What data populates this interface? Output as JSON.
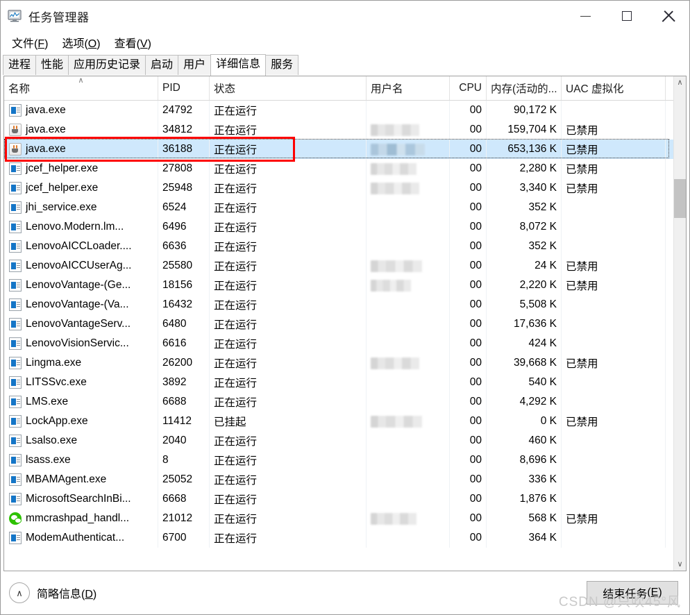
{
  "window": {
    "title": "任务管理器",
    "icon": "task-manager-icon",
    "controls": {
      "minimize": "—",
      "maximize": "□",
      "close": "✕"
    }
  },
  "menu": [
    {
      "label": "文件(F)",
      "text": "文件",
      "mnemonic": "F"
    },
    {
      "label": "选项(O)",
      "text": "选项",
      "mnemonic": "O"
    },
    {
      "label": "查看(V)",
      "text": "查看",
      "mnemonic": "V"
    }
  ],
  "tabs": [
    {
      "label": "进程",
      "active": false
    },
    {
      "label": "性能",
      "active": false
    },
    {
      "label": "应用历史记录",
      "active": false
    },
    {
      "label": "启动",
      "active": false
    },
    {
      "label": "用户",
      "active": false
    },
    {
      "label": "详细信息",
      "active": true
    },
    {
      "label": "服务",
      "active": false
    }
  ],
  "table": {
    "columns": [
      {
        "key": "name",
        "label": "名称",
        "align": "left",
        "sorted": true,
        "sort_dir": "asc"
      },
      {
        "key": "pid",
        "label": "PID",
        "align": "left"
      },
      {
        "key": "state",
        "label": "状态",
        "align": "left"
      },
      {
        "key": "user",
        "label": "用户名",
        "align": "left"
      },
      {
        "key": "cpu",
        "label": "CPU",
        "align": "right"
      },
      {
        "key": "mem",
        "label": "内存(活动的...",
        "align": "right"
      },
      {
        "key": "uac",
        "label": "UAC 虚拟化",
        "align": "left"
      }
    ],
    "sort_indicator": "∧",
    "rows": [
      {
        "icon": "generic-app-icon",
        "name": "java.exe",
        "pid": "24792",
        "state": "正在运行",
        "user_blurred": false,
        "user_width": "",
        "cpu": "00",
        "mem": "90,172 K",
        "uac": "",
        "selected": false
      },
      {
        "icon": "java-icon",
        "name": "java.exe",
        "pid": "34812",
        "state": "正在运行",
        "user_blurred": true,
        "user_width": "b1",
        "cpu": "00",
        "mem": "159,704 K",
        "uac": "已禁用",
        "selected": false
      },
      {
        "icon": "java-icon",
        "name": "java.exe",
        "pid": "36188",
        "state": "正在运行",
        "user_blurred": true,
        "user_width": "b2",
        "cpu": "00",
        "mem": "653,136 K",
        "uac": "已禁用",
        "selected": true
      },
      {
        "icon": "generic-app-icon",
        "name": "jcef_helper.exe",
        "pid": "27808",
        "state": "正在运行",
        "user_blurred": true,
        "user_width": "b3",
        "cpu": "00",
        "mem": "2,280 K",
        "uac": "已禁用",
        "selected": false
      },
      {
        "icon": "generic-app-icon",
        "name": "jcef_helper.exe",
        "pid": "25948",
        "state": "正在运行",
        "user_blurred": true,
        "user_width": "b1",
        "cpu": "00",
        "mem": "3,340 K",
        "uac": "已禁用",
        "selected": false
      },
      {
        "icon": "generic-app-icon",
        "name": "jhi_service.exe",
        "pid": "6524",
        "state": "正在运行",
        "user_blurred": false,
        "user_width": "",
        "cpu": "00",
        "mem": "352 K",
        "uac": "",
        "selected": false
      },
      {
        "icon": "generic-app-icon",
        "name": "Lenovo.Modern.lm...",
        "pid": "6496",
        "state": "正在运行",
        "user_blurred": false,
        "user_width": "",
        "cpu": "00",
        "mem": "8,072 K",
        "uac": "",
        "selected": false
      },
      {
        "icon": "generic-app-icon",
        "name": "LenovoAICCLoader....",
        "pid": "6636",
        "state": "正在运行",
        "user_blurred": false,
        "user_width": "",
        "cpu": "00",
        "mem": "352 K",
        "uac": "",
        "selected": false
      },
      {
        "icon": "generic-app-icon",
        "name": "LenovoAICCUserAg...",
        "pid": "25580",
        "state": "正在运行",
        "user_blurred": true,
        "user_width": "b5",
        "cpu": "00",
        "mem": "24 K",
        "uac": "已禁用",
        "selected": false
      },
      {
        "icon": "generic-app-icon",
        "name": "LenovoVantage-(Ge...",
        "pid": "18156",
        "state": "正在运行",
        "user_blurred": true,
        "user_width": "b4",
        "cpu": "00",
        "mem": "2,220 K",
        "uac": "已禁用",
        "selected": false
      },
      {
        "icon": "generic-app-icon",
        "name": "LenovoVantage-(Va...",
        "pid": "16432",
        "state": "正在运行",
        "user_blurred": false,
        "user_width": "",
        "cpu": "00",
        "mem": "5,508 K",
        "uac": "",
        "selected": false
      },
      {
        "icon": "generic-app-icon",
        "name": "LenovoVantageServ...",
        "pid": "6480",
        "state": "正在运行",
        "user_blurred": false,
        "user_width": "",
        "cpu": "00",
        "mem": "17,636 K",
        "uac": "",
        "selected": false
      },
      {
        "icon": "generic-app-icon",
        "name": "LenovoVisionServic...",
        "pid": "6616",
        "state": "正在运行",
        "user_blurred": false,
        "user_width": "",
        "cpu": "00",
        "mem": "424 K",
        "uac": "",
        "selected": false
      },
      {
        "icon": "generic-app-icon",
        "name": "Lingma.exe",
        "pid": "26200",
        "state": "正在运行",
        "user_blurred": true,
        "user_width": "b1",
        "cpu": "00",
        "mem": "39,668 K",
        "uac": "已禁用",
        "selected": false
      },
      {
        "icon": "generic-app-icon",
        "name": "LITSSvc.exe",
        "pid": "3892",
        "state": "正在运行",
        "user_blurred": false,
        "user_width": "",
        "cpu": "00",
        "mem": "540 K",
        "uac": "",
        "selected": false
      },
      {
        "icon": "generic-app-icon",
        "name": "LMS.exe",
        "pid": "6688",
        "state": "正在运行",
        "user_blurred": false,
        "user_width": "",
        "cpu": "00",
        "mem": "4,292 K",
        "uac": "",
        "selected": false
      },
      {
        "icon": "generic-app-icon",
        "name": "LockApp.exe",
        "pid": "11412",
        "state": "已挂起",
        "user_blurred": true,
        "user_width": "b5",
        "cpu": "00",
        "mem": "0 K",
        "uac": "已禁用",
        "selected": false
      },
      {
        "icon": "generic-app-icon",
        "name": "Lsalso.exe",
        "pid": "2040",
        "state": "正在运行",
        "user_blurred": false,
        "user_width": "",
        "cpu": "00",
        "mem": "460 K",
        "uac": "",
        "selected": false
      },
      {
        "icon": "generic-app-icon",
        "name": "lsass.exe",
        "pid": "8",
        "state": "正在运行",
        "user_blurred": false,
        "user_width": "",
        "cpu": "00",
        "mem": "8,696 K",
        "uac": "",
        "selected": false
      },
      {
        "icon": "generic-app-icon",
        "name": "MBAMAgent.exe",
        "pid": "25052",
        "state": "正在运行",
        "user_blurred": false,
        "user_width": "",
        "cpu": "00",
        "mem": "336 K",
        "uac": "",
        "selected": false
      },
      {
        "icon": "generic-app-icon",
        "name": "MicrosoftSearchInBi...",
        "pid": "6668",
        "state": "正在运行",
        "user_blurred": false,
        "user_width": "",
        "cpu": "00",
        "mem": "1,876 K",
        "uac": "",
        "selected": false
      },
      {
        "icon": "wechat-icon",
        "name": "mmcrashpad_handl...",
        "pid": "21012",
        "state": "正在运行",
        "user_blurred": true,
        "user_width": "b3",
        "cpu": "00",
        "mem": "568 K",
        "uac": "已禁用",
        "selected": false
      },
      {
        "icon": "generic-app-icon",
        "name": "ModemAuthenticat...",
        "pid": "6700",
        "state": "正在运行",
        "user_blurred": false,
        "user_width": "",
        "cpu": "00",
        "mem": "364 K",
        "uac": "",
        "selected": false
      }
    ]
  },
  "scrollbar": {
    "up_glyph": "∧",
    "down_glyph": "∨"
  },
  "statusbar": {
    "fewer_details_label": "简略信息(D)",
    "fewer_details_text": "简略信息",
    "fewer_details_mnemonic": "D",
    "fewer_details_chevron": "∧",
    "end_task_label": "结束任务(E)",
    "end_task_text": "结束任务",
    "end_task_mnemonic": "E"
  },
  "watermark": "CSDN @只吹45°风",
  "colors": {
    "selection": "#cfe8fc",
    "annotation": "#fe0000",
    "accent": "#1475c7"
  }
}
